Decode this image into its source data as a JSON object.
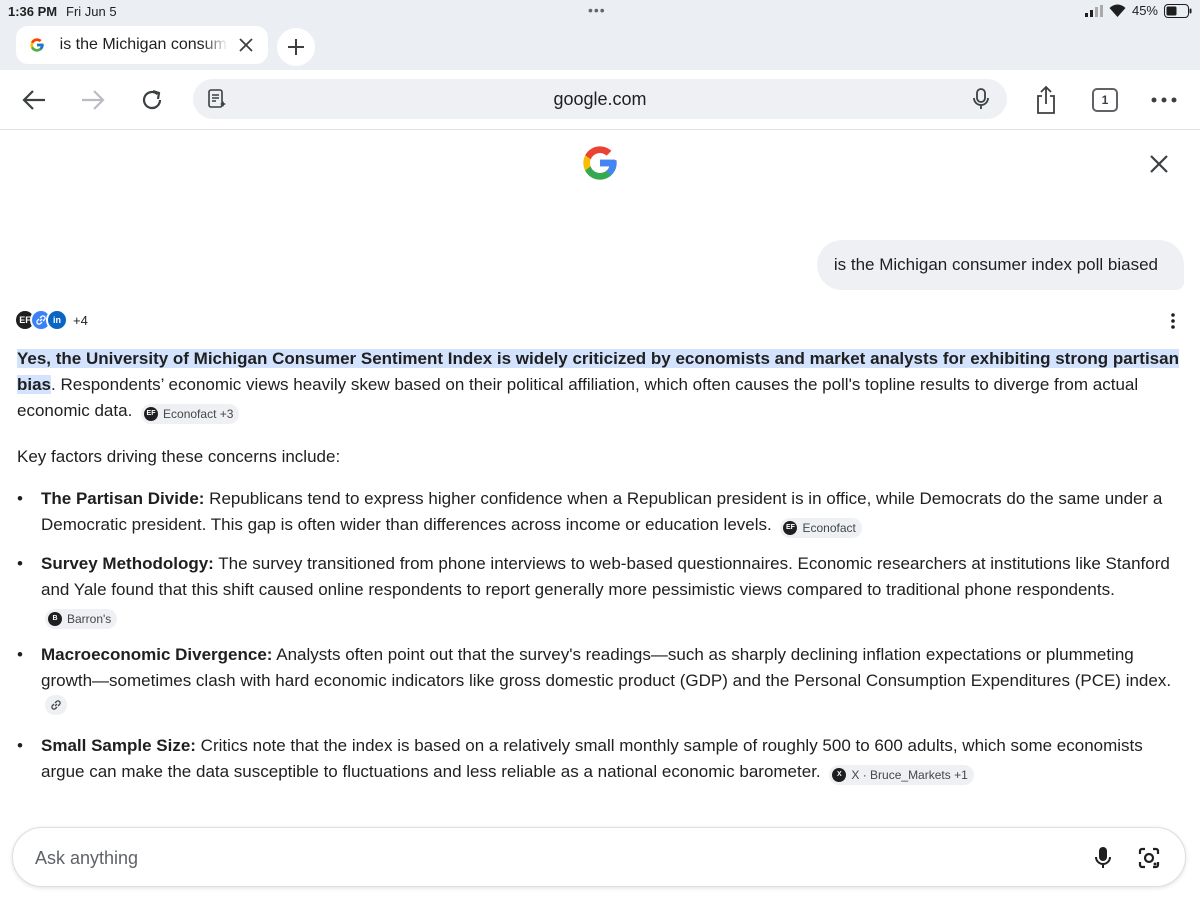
{
  "status_bar": {
    "time": "1:36 PM",
    "date": "Fri Jun 5",
    "battery": "45%"
  },
  "tab": {
    "title": "is the Michigan consumer index poll biased",
    "favicon": "google-g-icon"
  },
  "toolbar": {
    "url": "google.com",
    "tab_count": "1"
  },
  "query": "is the Michigan consumer index poll biased",
  "sources": {
    "extra_count": "+4"
  },
  "answer": {
    "highlight": "Yes, the University of Michigan Consumer Sentiment Index is widely criticized by economists and market analysts for exhibiting strong partisan bias",
    "rest": ". Respondents’ economic views heavily skew based on their political affiliation, which often causes the poll's topline results to diverge from actual economic data.",
    "citation": "Econofact +3"
  },
  "intro": "Key factors driving these concerns include:",
  "bullets": [
    {
      "title": "The Partisan Divide:",
      "text": " Republicans tend to express higher confidence when a Republican president is in office, while Democrats do the same under a Democratic president. This gap is often wider than differences across income or education levels.",
      "citation": "Econofact"
    },
    {
      "title": "Survey Methodology:",
      "text": " The survey transitioned from phone interviews to web-based questionnaires. Economic researchers at institutions like Stanford and Yale found that this shift caused online respondents to report generally more pessimistic views compared to traditional phone respondents.",
      "citation": "Barron's"
    },
    {
      "title": "Macroeconomic Divergence:",
      "text": " Analysts often point out that the survey's readings—such as sharply declining inflation expectations or plummeting growth—sometimes clash with hard economic indicators like gross domestic product (GDP) and the Personal Consumption Expenditures (PCE) index."
    },
    {
      "title": "Small Sample Size:",
      "text": " Critics note that the index is based on a relatively small monthly sample of roughly 500 to 600 adults, which some economists argue can make the data susceptible to fluctuations and less reliable as a national economic barometer.",
      "citation": "X · Bruce_Markets +1"
    }
  ],
  "ask": {
    "placeholder": "Ask anything"
  },
  "colors": {
    "highlight": "#d3e3fd",
    "google_blue": "#4285f4",
    "google_red": "#ea4335",
    "google_yellow": "#fbbc05",
    "google_green": "#34a853"
  }
}
